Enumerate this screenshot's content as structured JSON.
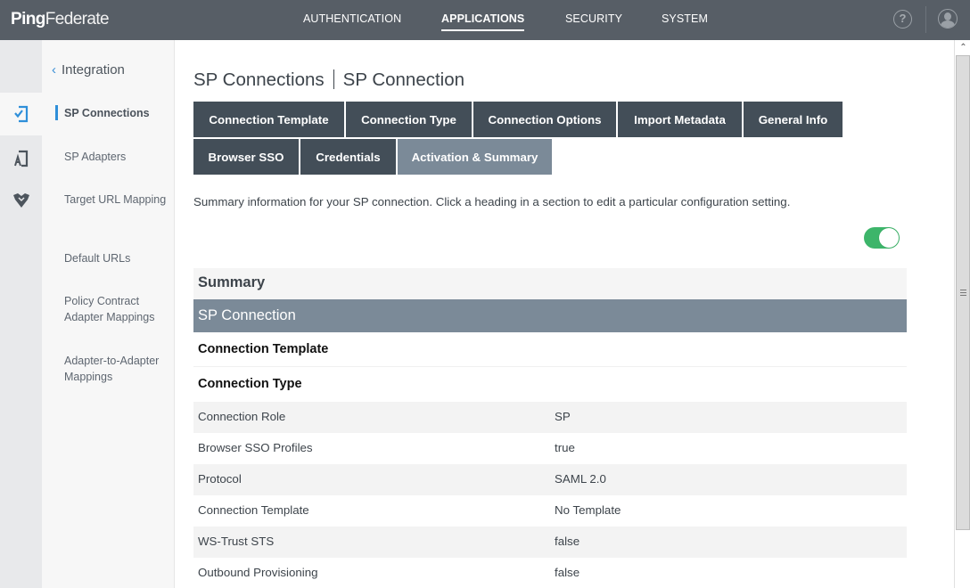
{
  "app": {
    "logo_bold": "Ping",
    "logo_light": "Federate"
  },
  "topnav": {
    "items": [
      {
        "label": "AUTHENTICATION",
        "active": false
      },
      {
        "label": "APPLICATIONS",
        "active": true
      },
      {
        "label": "SECURITY",
        "active": false
      },
      {
        "label": "SYSTEM",
        "active": false
      }
    ],
    "help_icon": "?",
    "user_icon": "user-avatar"
  },
  "rail": {
    "items": [
      {
        "icon": "sp-connection-icon",
        "active": true
      },
      {
        "icon": "sp-adapter-icon",
        "active": false
      },
      {
        "icon": "policy-shield-icon",
        "active": false
      }
    ]
  },
  "subnav": {
    "back_label": "Integration",
    "items": [
      {
        "label": "SP Connections",
        "active": true
      },
      {
        "label": "SP Adapters",
        "active": false
      },
      {
        "label": "Target URL Mapping",
        "active": false
      },
      {
        "label": "Default URLs",
        "active": false
      },
      {
        "label": "Policy Contract Adapter Mappings",
        "active": false
      },
      {
        "label": "Adapter-to-Adapter Mappings",
        "active": false
      }
    ]
  },
  "page": {
    "title_part1": "SP Connections",
    "title_part2": "SP Connection",
    "description": "Summary information for your SP connection. Click a heading in a section to edit a particular configuration setting.",
    "connection_enabled": true
  },
  "tabs": [
    {
      "label": "Connection Template",
      "active": false
    },
    {
      "label": "Connection Type",
      "active": false
    },
    {
      "label": "Connection Options",
      "active": false
    },
    {
      "label": "Import Metadata",
      "active": false
    },
    {
      "label": "General Info",
      "active": false
    },
    {
      "label": "Browser SSO",
      "active": false
    },
    {
      "label": "Credentials",
      "active": false
    },
    {
      "label": "Activation & Summary",
      "active": true
    }
  ],
  "summary": {
    "heading": "Summary",
    "section": "SP Connection",
    "subsections": [
      "Connection Template",
      "Connection Type"
    ],
    "rows": [
      {
        "key": "Connection Role",
        "value": "SP"
      },
      {
        "key": "Browser SSO Profiles",
        "value": "true"
      },
      {
        "key": "Protocol",
        "value": "SAML 2.0"
      },
      {
        "key": "Connection Template",
        "value": "No Template"
      },
      {
        "key": "WS-Trust STS",
        "value": "false"
      },
      {
        "key": "Outbound Provisioning",
        "value": "false"
      }
    ]
  },
  "colors": {
    "topbar": "#575e66",
    "tab": "#434e58",
    "tab_active": "#7b8a98",
    "accent_blue": "#2f8fd9",
    "toggle_on": "#3db56a"
  }
}
